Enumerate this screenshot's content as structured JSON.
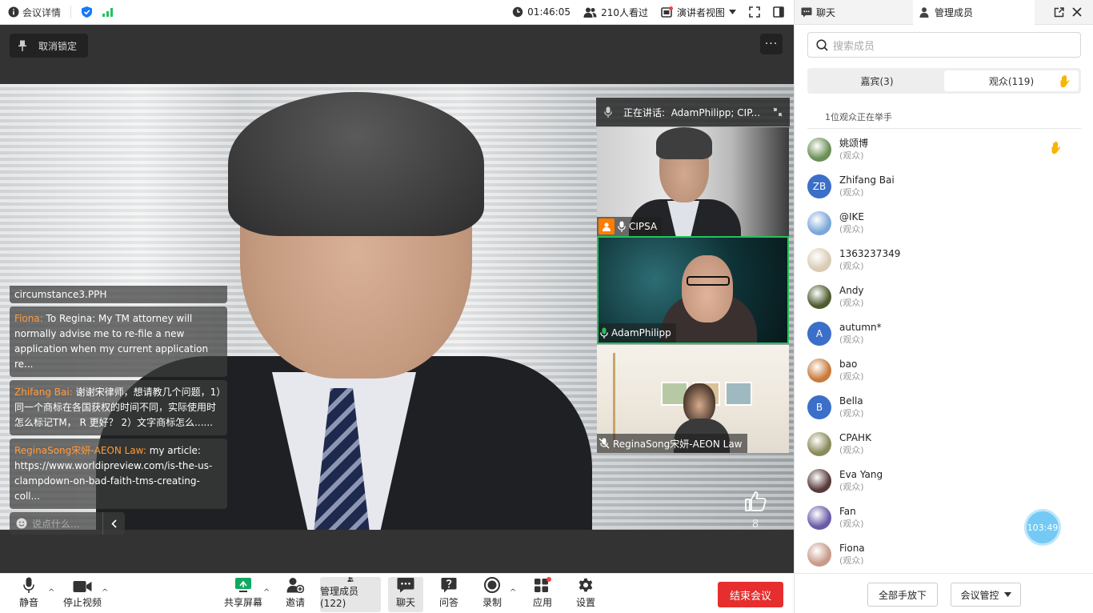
{
  "topbar": {
    "meeting_info_label": "会议详情",
    "timer": "01:46:05",
    "viewers": "210人看过",
    "view_mode": "演讲者视图"
  },
  "stage": {
    "unlock_label": "取消锁定",
    "more_label": "···",
    "speaker_prefix": "正在讲话:",
    "speaker_names": "AdamPhilipp; CIP...",
    "like_count": "8"
  },
  "chat": {
    "partial_text": "circumstance3.PPH",
    "messages": [
      {
        "name": "Fiona:",
        "text": " To Regina: My TM attorney will normally advise me to re-file a new application when my current application re..."
      },
      {
        "name": " Zhifang Bai:",
        "text": " 谢谢宋律师，想请教几个问题，1）同一个商标在各国获权的时间不同，实际使用时怎么标记TM， R 更好？ 2）文字商标怎么......"
      },
      {
        "name": "ReginaSong宋妍-AEON Law:",
        "text": " my article: https://www.worldipreview.com/is-the-us-clampdown-on-bad-faith-tms-creating-coll..."
      }
    ],
    "input_placeholder": "说点什么..."
  },
  "thumbnails": [
    {
      "name": "CIPSA"
    },
    {
      "name": "AdamPhilipp"
    },
    {
      "name": "ReginaSong宋妍-AEON Law"
    }
  ],
  "toolbar": {
    "mute": "静音",
    "stop_video": "停止视频",
    "share": "共享屏幕",
    "invite": "邀请",
    "members": "管理成员(122)",
    "chat": "聊天",
    "qa": "问答",
    "record": "录制",
    "apps": "应用",
    "settings": "设置",
    "end": "结束会议"
  },
  "sidebar": {
    "tab_chat": "聊天",
    "tab_members": "管理成员",
    "search_placeholder": "搜索成员",
    "seg_guests": "嘉宾(3)",
    "seg_audience": "观众(119)",
    "raise_note": "1位观众正在举手",
    "members": [
      {
        "name": "姚颂博",
        "role": "(观众)",
        "initials": "",
        "color": "#6b8f55",
        "hand": true
      },
      {
        "name": " Zhifang Bai",
        "role": "(观众)",
        "initials": "ZB",
        "color": "#3b6fc9",
        "hand": false
      },
      {
        "name": "@IKE",
        "role": "(观众)",
        "initials": "",
        "color": "#7aa7d9",
        "hand": false
      },
      {
        "name": "1363237349",
        "role": "(观众)",
        "initials": "",
        "color": "#d9cbb5",
        "hand": false
      },
      {
        "name": "Andy",
        "role": "(观众)",
        "initials": "",
        "color": "#4d5b2e",
        "hand": false
      },
      {
        "name": "autumn*",
        "role": "(观众)",
        "initials": "A",
        "color": "#3b6fc9",
        "hand": false
      },
      {
        "name": "bao",
        "role": "(观众)",
        "initials": "",
        "color": "#c97a3b",
        "hand": false
      },
      {
        "name": "Bella",
        "role": "(观众)",
        "initials": "B",
        "color": "#3b6fc9",
        "hand": false
      },
      {
        "name": "CPAHK",
        "role": "(观众)",
        "initials": "",
        "color": "#8a8a5a",
        "hand": false
      },
      {
        "name": "Eva Yang",
        "role": "(观众)",
        "initials": "",
        "color": "#5a3a3a",
        "hand": false
      },
      {
        "name": "Fan",
        "role": "(观众)",
        "initials": "",
        "color": "#6a5aa8",
        "hand": false
      },
      {
        "name": "Fiona",
        "role": "(观众)",
        "initials": "",
        "color": "#c99a8a",
        "hand": false
      }
    ],
    "lower_all_hands": "全部手放下",
    "meeting_control": "会议管控",
    "floating_timer": "103:49"
  }
}
